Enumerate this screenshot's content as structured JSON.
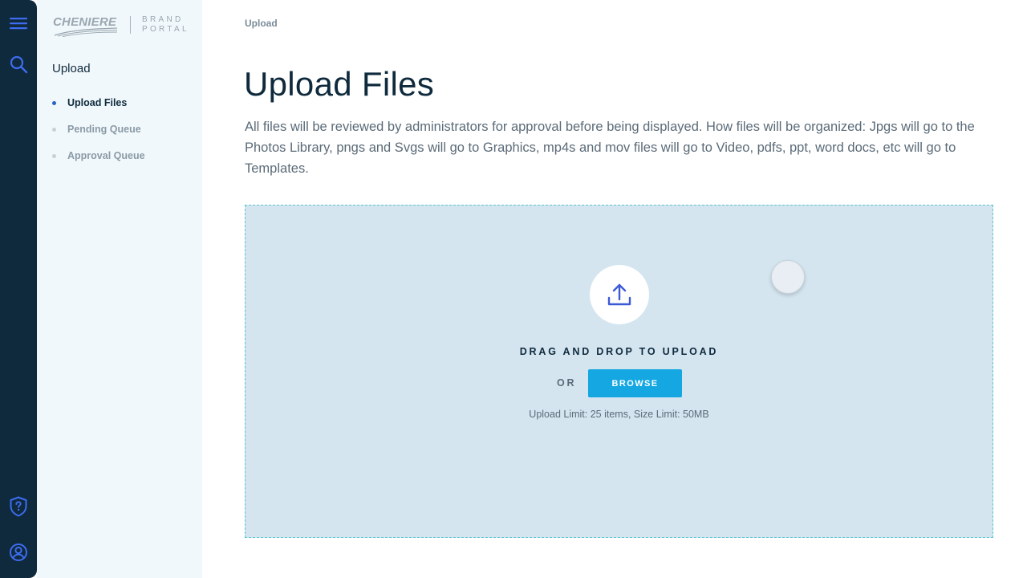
{
  "app": {
    "logo_word": "CHENIERE",
    "logo_brand_line1": "BRAND",
    "logo_brand_line2": "PORTAL"
  },
  "rail": {
    "icons": [
      "menu-icon",
      "search-icon",
      "help-shield-icon",
      "user-icon"
    ],
    "accent": "#3d6cf0"
  },
  "sidebar": {
    "section_title": "Upload",
    "items": [
      {
        "label": "Upload Files",
        "active": true
      },
      {
        "label": "Pending Queue",
        "active": false
      },
      {
        "label": "Approval Queue",
        "active": false
      }
    ]
  },
  "main": {
    "breadcrumb": "Upload",
    "title": "Upload Files",
    "description": "All files will be reviewed by administrators for approval before being displayed. How files will be organized: Jpgs will go to the Photos Library, pngs and Svgs will go to Graphics, mp4s and mov files will go to Video, pdfs, ppt, word docs, etc will go to Templates."
  },
  "dropzone": {
    "drag_text": "DRAG AND DROP TO UPLOAD",
    "or_text": "OR",
    "browse_label": "BROWSE",
    "limits_text": "Upload Limit: 25 items, Size Limit: 50MB"
  },
  "colors": {
    "rail_bg": "#0f2a3d",
    "sidebar_bg": "#f1f8fb",
    "dropzone_bg": "#d4e5f0",
    "button": "#14a7e2",
    "title": "#0f2a3d"
  }
}
